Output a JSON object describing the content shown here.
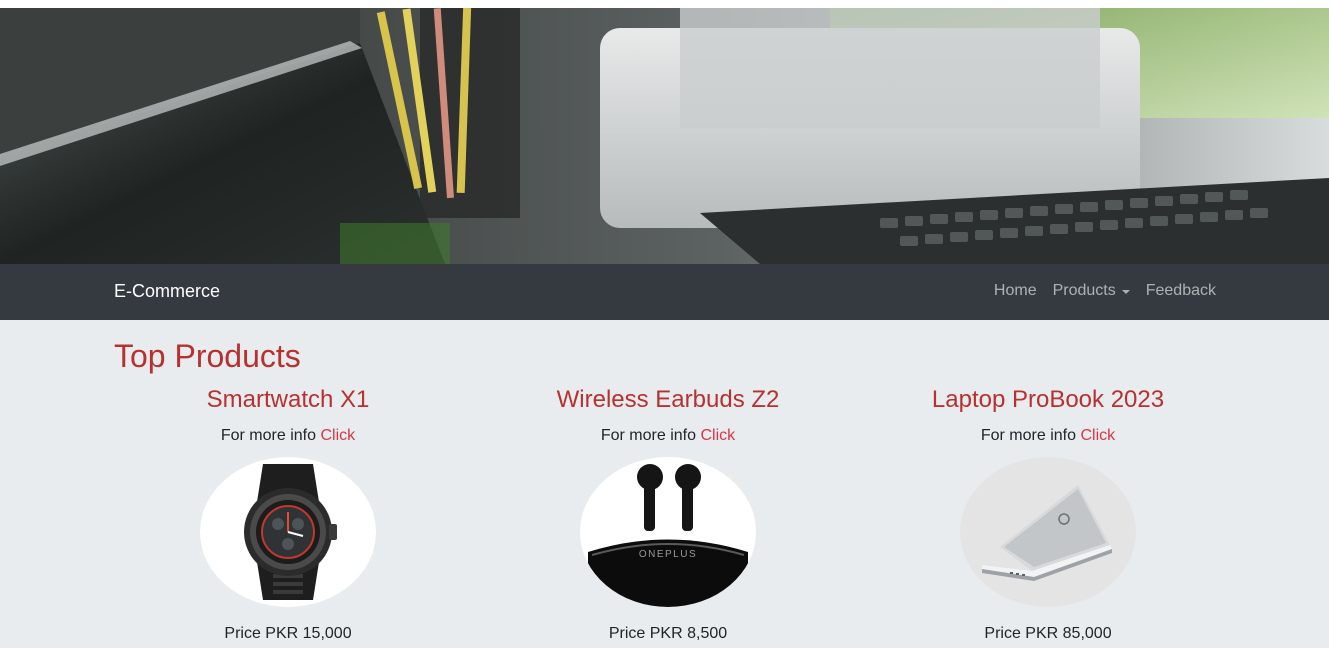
{
  "navbar": {
    "brand": "E-Commerce",
    "links": [
      {
        "label": "Home"
      },
      {
        "label": "Products"
      },
      {
        "label": "Feedback"
      }
    ]
  },
  "main": {
    "title": "Top Products",
    "products": [
      {
        "name": "Smartwatch X1",
        "info_text": "For more info",
        "info_link": "Click",
        "price": "Price PKR 15,000",
        "image": "smartwatch"
      },
      {
        "name": "Wireless Earbuds Z2",
        "info_text": "For more info",
        "info_link": "Click",
        "price": "Price PKR 8,500",
        "image": "earbuds"
      },
      {
        "name": "Laptop ProBook 2023",
        "info_text": "For more info",
        "info_link": "Click",
        "price": "Price PKR 85,000",
        "image": "laptop"
      }
    ],
    "earbuds_case_logo": "ONEPLUS"
  },
  "colors": {
    "accent": "#b8312f",
    "link": "#dc3545",
    "navbar_bg": "#343a40",
    "page_bg": "#e9ecef"
  }
}
